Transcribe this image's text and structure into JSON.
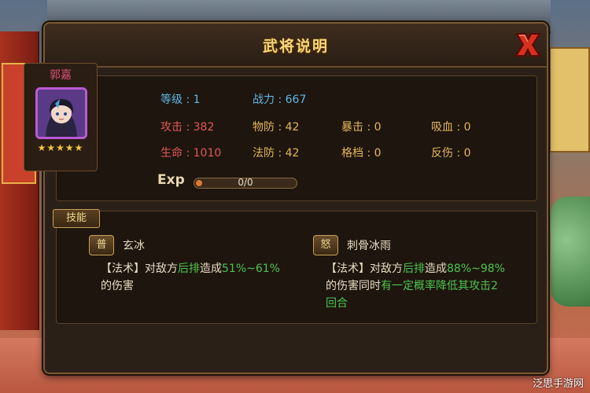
{
  "panel": {
    "title": "武将说明"
  },
  "hero": {
    "name": "郭嘉",
    "stars": "★★★★★",
    "star_count": 5
  },
  "stats": {
    "level": {
      "label": "等级",
      "sep": " : ",
      "value": "1"
    },
    "power": {
      "label": "战力",
      "sep": " : ",
      "value": "667"
    },
    "attack": {
      "label": "攻击",
      "sep": " : ",
      "value": "382"
    },
    "pdef": {
      "label": "物防",
      "sep": " : ",
      "value": "42"
    },
    "crit": {
      "label": "暴击",
      "sep": " : ",
      "value": "0"
    },
    "lifesteal": {
      "label": "吸血",
      "sep": " : ",
      "value": "0"
    },
    "hp": {
      "label": "生命",
      "sep": " : ",
      "value": "1010"
    },
    "mdef": {
      "label": "法防",
      "sep": " : ",
      "value": "42"
    },
    "block": {
      "label": "格档",
      "sep": " : ",
      "value": "0"
    },
    "reflect": {
      "label": "反伤",
      "sep": " : ",
      "value": "0"
    }
  },
  "exp": {
    "label": "Exp",
    "text": "0/0",
    "progress": 0
  },
  "skills_tab": "技能",
  "skills": [
    {
      "badge": "普",
      "name": "玄冰",
      "desc_parts": [
        {
          "text": "【法术】对敌方",
          "style": "normal"
        },
        {
          "text": "后排",
          "style": "green"
        },
        {
          "text": "造成",
          "style": "normal"
        },
        {
          "text": "51%~61%",
          "style": "green"
        }
      ],
      "desc_line2": "的伤害"
    },
    {
      "badge": "怒",
      "name": "刺骨冰雨",
      "desc_parts": [
        {
          "text": "【法术】对敌方",
          "style": "normal"
        },
        {
          "text": "后排",
          "style": "green"
        },
        {
          "text": "造成",
          "style": "normal"
        },
        {
          "text": "88%~98%",
          "style": "green"
        }
      ],
      "desc_line2_parts": [
        {
          "text": "的伤害同时",
          "style": "normal"
        },
        {
          "text": "有一定概率降低其攻击2",
          "style": "green"
        }
      ],
      "desc_line3": "回合"
    }
  ],
  "watermark": "泛思手游网",
  "colors": {
    "gold_title": "#f6d77a",
    "blue_stat": "#5eb8e6",
    "red_stat": "#e15a5a",
    "gold_stat": "#e3b85a",
    "green_highlight": "#4ec44e"
  }
}
